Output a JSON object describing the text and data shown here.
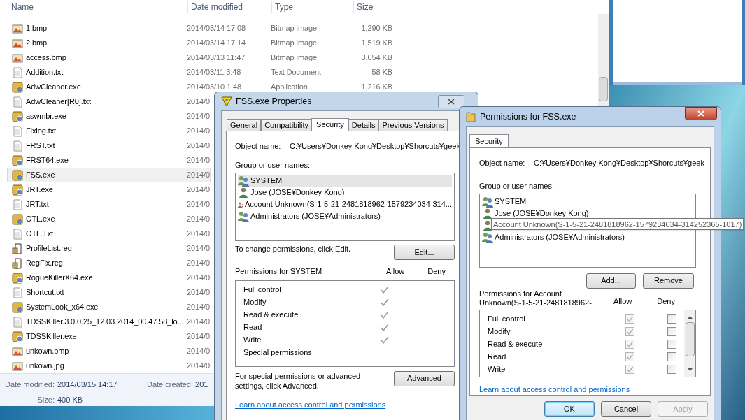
{
  "explorer": {
    "columns": [
      "Name",
      "Date modified",
      "Type",
      "Size"
    ],
    "files": [
      {
        "name": "1.bmp",
        "kind": "image",
        "date": "2014/03/14 17:08",
        "type": "Bitmap image",
        "size": "1,290 KB",
        "selected": false
      },
      {
        "name": "2.bmp",
        "kind": "image",
        "date": "2014/03/14 17:14",
        "type": "Bitmap image",
        "size": "1,519 KB",
        "selected": false
      },
      {
        "name": "access.bmp",
        "kind": "image",
        "date": "2014/03/13 11:47",
        "type": "Bitmap image",
        "size": "3,054 KB",
        "selected": false
      },
      {
        "name": "Addition.txt",
        "kind": "text",
        "date": "2014/03/11 3:48",
        "type": "Text Document",
        "size": "58 KB",
        "selected": false
      },
      {
        "name": "AdwCleaner.exe",
        "kind": "app",
        "date": "2014/03/10 1:48",
        "type": "Application",
        "size": "1,216 KB",
        "selected": false
      },
      {
        "name": "AdwCleaner[R0].txt",
        "kind": "text",
        "date": "2014/0",
        "selected": false
      },
      {
        "name": "aswmbr.exe",
        "kind": "app",
        "date": "2014/0",
        "selected": false
      },
      {
        "name": "Fixlog.txt",
        "kind": "text",
        "date": "2014/0",
        "selected": false
      },
      {
        "name": "FRST.txt",
        "kind": "text",
        "date": "2014/0",
        "selected": false
      },
      {
        "name": "FRST64.exe",
        "kind": "app",
        "date": "2014/0",
        "selected": false
      },
      {
        "name": "FSS.exe",
        "kind": "app",
        "date": "2014/0",
        "selected": true
      },
      {
        "name": "JRT.exe",
        "kind": "app",
        "date": "2014/0",
        "selected": false
      },
      {
        "name": "JRT.txt",
        "kind": "text",
        "date": "2014/0",
        "selected": false
      },
      {
        "name": "OTL.exe",
        "kind": "app",
        "date": "2014/0",
        "selected": false
      },
      {
        "name": "OTL.Txt",
        "kind": "text",
        "date": "2014/0",
        "selected": false
      },
      {
        "name": "ProfileList.reg",
        "kind": "reg",
        "date": "2014/0",
        "selected": false
      },
      {
        "name": "RegFix.reg",
        "kind": "reg",
        "date": "2014/0",
        "selected": false
      },
      {
        "name": "RogueKillerX64.exe",
        "kind": "app",
        "date": "2014/0",
        "selected": false
      },
      {
        "name": "Shortcut.txt",
        "kind": "text",
        "date": "2014/0",
        "selected": false
      },
      {
        "name": "SystemLook_x64.exe",
        "kind": "app",
        "date": "2014/0",
        "selected": false
      },
      {
        "name": "TDSSKiller.3.0.0.25_12.03.2014_00.47.58_lo...",
        "kind": "text",
        "date": "2014/0",
        "selected": false
      },
      {
        "name": "TDSSKiller.exe",
        "kind": "app",
        "date": "2014/0",
        "selected": false
      },
      {
        "name": "unkown.bmp",
        "kind": "image",
        "date": "2014/0",
        "selected": false
      },
      {
        "name": "unkown.jpg",
        "kind": "image",
        "date": "2014/0",
        "selected": false
      }
    ],
    "details": {
      "modified_label": "Date modified:",
      "modified": "2014/03/15 14:17",
      "created_label": "Date created:",
      "created": "201",
      "size_label": "Size:",
      "size": "400 KB"
    }
  },
  "properties": {
    "title": "FSS.exe Properties",
    "tabs": [
      {
        "label": "General",
        "selected": false
      },
      {
        "label": "Compatibility",
        "selected": false
      },
      {
        "label": "Security",
        "selected": true
      },
      {
        "label": "Details",
        "selected": false
      },
      {
        "label": "Previous Versions",
        "selected": false
      }
    ],
    "object_label": "Object name:",
    "object_value": "C:¥Users¥Donkey Kong¥Desktop¥Shorcuts¥geek",
    "users_label": "Group or user names:",
    "users": [
      {
        "name": "SYSTEM",
        "kind": "group",
        "selected": true
      },
      {
        "name": "Jose (JOSE¥Donkey Kong)",
        "kind": "user",
        "selected": false
      },
      {
        "name": "Account Unknown(S-1-5-21-2481818962-1579234034-314...",
        "kind": "unknown",
        "selected": false
      },
      {
        "name": "Administrators (JOSE¥Administrators)",
        "kind": "group",
        "selected": false
      }
    ],
    "edit_hint": "To change permissions, click Edit.",
    "edit_button": "Edit...",
    "perm_header": "Permissions for SYSTEM",
    "allow_label": "Allow",
    "deny_label": "Deny",
    "permissions": [
      {
        "name": "Full control",
        "allow": true
      },
      {
        "name": "Modify",
        "allow": true
      },
      {
        "name": "Read & execute",
        "allow": true
      },
      {
        "name": "Read",
        "allow": true
      },
      {
        "name": "Write",
        "allow": true
      },
      {
        "name": "Special permissions",
        "allow": false
      }
    ],
    "advanced_hint": "For special permissions or advanced settings, click Advanced.",
    "advanced_button": "Advanced",
    "link": "Learn about access control and permissions"
  },
  "permissions_dialog": {
    "title": "Permissions for FSS.exe",
    "tab": "Security",
    "object_label": "Object name:",
    "object_value": "C:¥Users¥Donkey Kong¥Desktop¥Shorcuts¥geek",
    "users_label": "Group or user names:",
    "users": [
      {
        "name": "SYSTEM",
        "kind": "group"
      },
      {
        "name": "Jose (JOSE¥Donkey Kong)",
        "kind": "user"
      },
      {
        "kind": "user"
      },
      {
        "name": "Administrators (JOSE¥Administrators)",
        "kind": "group"
      }
    ],
    "tooltip": "Account Unknown(S-1-5-21-2481818962-1579234034-314252365-1017)",
    "add_button": "Add...",
    "remove_button": "Remove",
    "perm_header": "Permissions for Account Unknown(S-1-5-21-2481818962-",
    "allow_label": "Allow",
    "deny_label": "Deny",
    "permissions": [
      {
        "name": "Full control",
        "allow": true,
        "deny": false
      },
      {
        "name": "Modify",
        "allow": true,
        "deny": false
      },
      {
        "name": "Read & execute",
        "allow": true,
        "deny": false
      },
      {
        "name": "Read",
        "allow": true,
        "deny": false
      },
      {
        "name": "Write",
        "allow": true,
        "deny": false
      }
    ],
    "allow_disabled": true,
    "link": "Learn about access control and permissions",
    "buttons": [
      {
        "label": "OK",
        "disabled": false,
        "default": true
      },
      {
        "label": "Cancel",
        "disabled": false,
        "default": false
      },
      {
        "label": "Apply",
        "disabled": true,
        "default": false
      }
    ]
  }
}
